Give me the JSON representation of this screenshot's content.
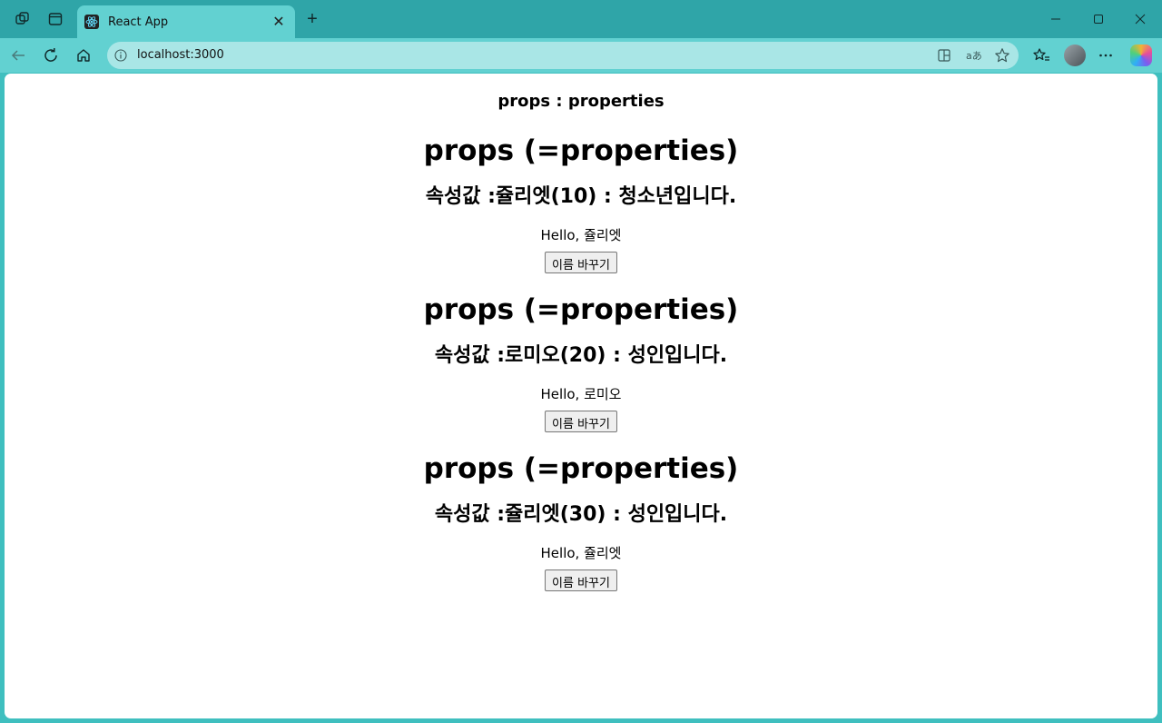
{
  "browser": {
    "tab_title": "React App",
    "url": "localhost:3000",
    "accent_color": "#3fbfbf"
  },
  "app": {
    "heading": "props : properties",
    "blocks": [
      {
        "title": "props (=properties)",
        "attr_text": "속성값 :쥴리엣(10) : 청소년입니다.",
        "greeting": "Hello, 쥴리엣",
        "button_label": "이름 바꾸기"
      },
      {
        "title": "props (=properties)",
        "attr_text": "속성값 :로미오(20) : 성인입니다.",
        "greeting": "Hello, 로미오",
        "button_label": "이름 바꾸기"
      },
      {
        "title": "props (=properties)",
        "attr_text": "속성값 :쥴리엣(30) : 성인입니다.",
        "greeting": "Hello, 쥴리엣",
        "button_label": "이름 바꾸기"
      }
    ]
  }
}
